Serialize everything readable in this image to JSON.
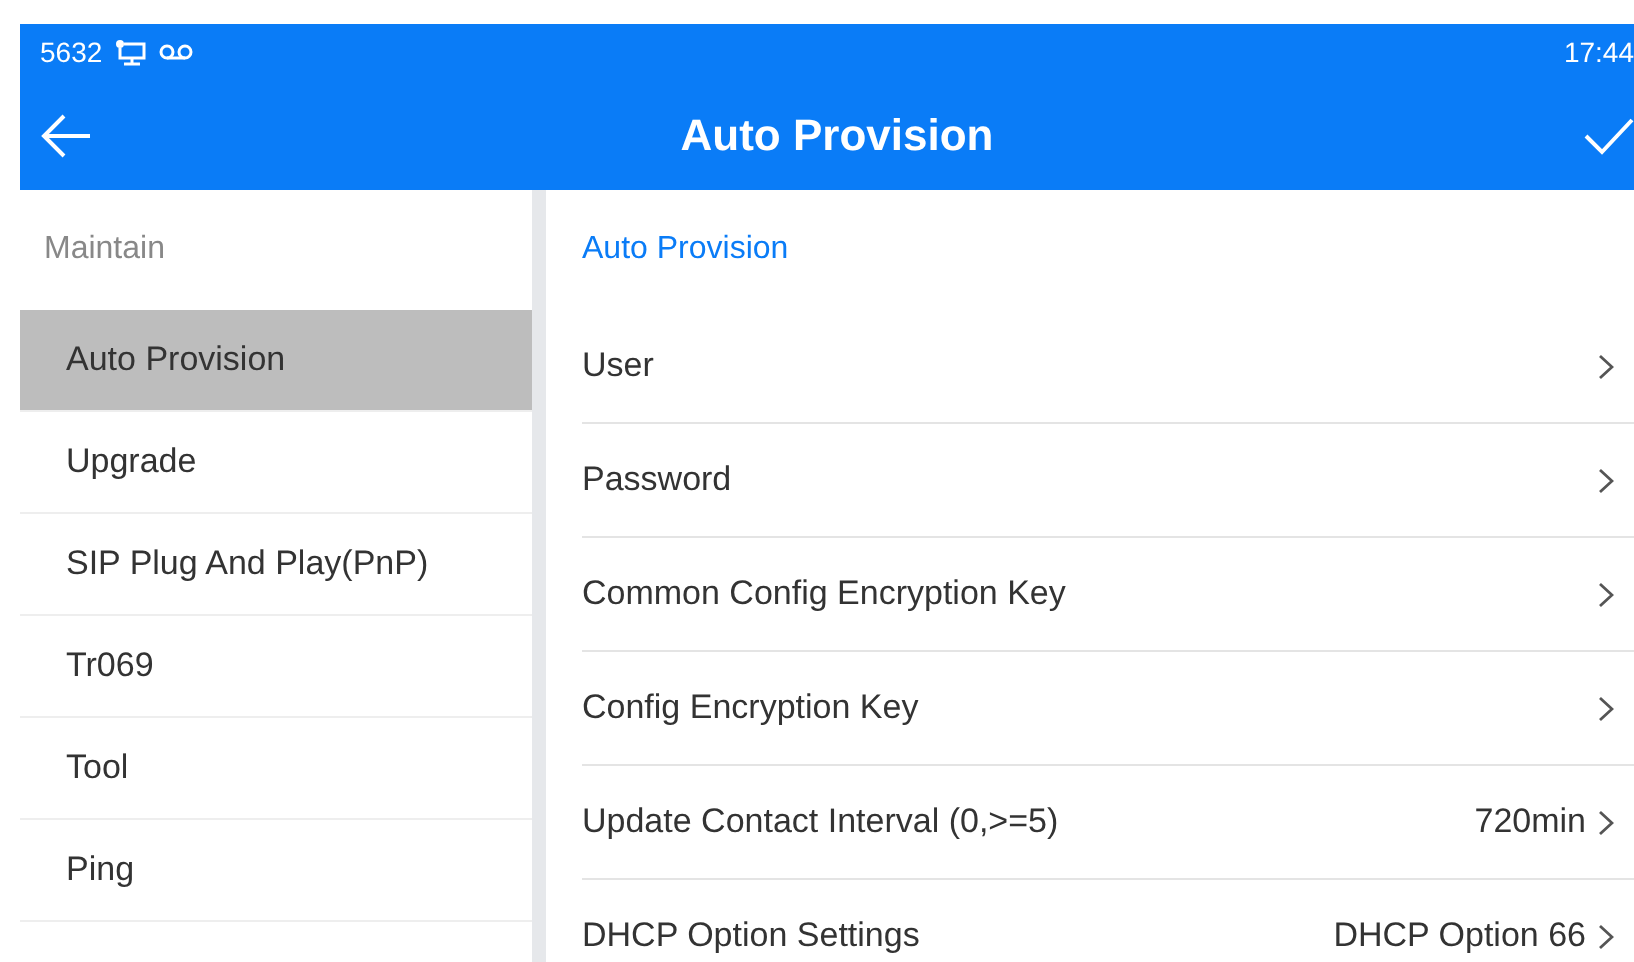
{
  "status_bar": {
    "extension": "5632",
    "time": "17:44"
  },
  "title_bar": {
    "title": "Auto Provision"
  },
  "sidebar": {
    "heading": "Maintain",
    "items": [
      {
        "label": "Auto Provision",
        "selected": true
      },
      {
        "label": "Upgrade",
        "selected": false
      },
      {
        "label": "SIP Plug And Play(PnP)",
        "selected": false
      },
      {
        "label": "Tr069",
        "selected": false
      },
      {
        "label": "Tool",
        "selected": false
      },
      {
        "label": "Ping",
        "selected": false
      }
    ]
  },
  "panel": {
    "heading": "Auto Provision",
    "rows": [
      {
        "label": "User"
      },
      {
        "label": "Password"
      },
      {
        "label": "Common Config Encryption Key"
      },
      {
        "label": "Config Encryption Key"
      },
      {
        "label": "Update Contact Interval (0,>=5)",
        "value": "720min"
      },
      {
        "label": "DHCP Option Settings",
        "value": "DHCP Option 66"
      }
    ]
  }
}
